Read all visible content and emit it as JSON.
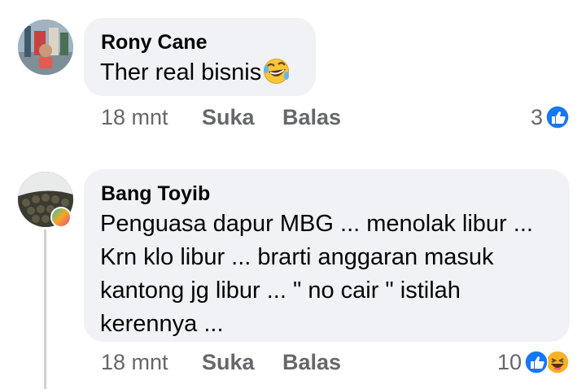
{
  "comments": [
    {
      "author": "Rony Cane",
      "text": "Ther real bisnis",
      "emoji_icon": "rolling-laughing-emoji",
      "time": "18 mnt",
      "like_label": "Suka",
      "reply_label": "Balas",
      "reaction_count": "3",
      "reactions": [
        "like"
      ]
    },
    {
      "author": "Bang Toyib",
      "text_lines": [
        "Penguasa dapur MBG ... menolak libur ...",
        "Krn klo libur ... brarti anggaran masuk",
        "kantong jg libur ... \" no cair \" istilah",
        "kerennya ..."
      ],
      "time": "18 mnt",
      "like_label": "Suka",
      "reply_label": "Balas",
      "reaction_count": "10",
      "reactions": [
        "like",
        "haha"
      ]
    }
  ],
  "colors": {
    "bubble": "#f0f2f5",
    "meta_text": "#65676b",
    "like_blue": "#1877f2",
    "haha_yellow": "#f7b125"
  }
}
